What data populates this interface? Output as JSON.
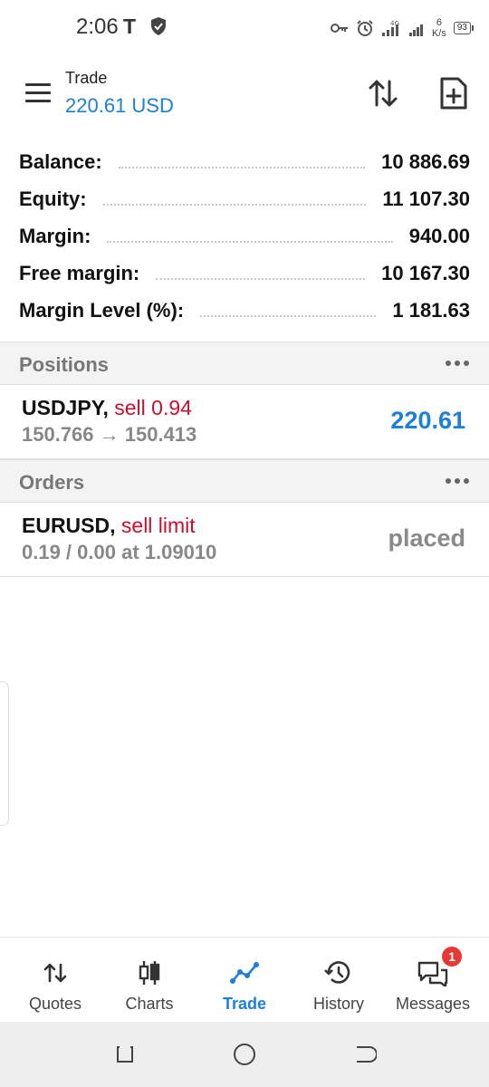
{
  "status_bar": {
    "time": "2:06",
    "carrier_glyph": "T",
    "network_type": "4G",
    "speed_value": "6",
    "speed_unit": "K/s",
    "battery": "93",
    "icons": [
      "shield-icon",
      "key-icon",
      "alarm-icon",
      "signal-icon",
      "signal-icon"
    ]
  },
  "header": {
    "title": "Trade",
    "subtitle": "220.61 USD",
    "accent_color": "#1e7fd6",
    "icons": [
      "menu-icon",
      "sort-icon",
      "new-order-icon"
    ]
  },
  "summary": [
    {
      "label": "Balance:",
      "value": "10 886.69"
    },
    {
      "label": "Equity:",
      "value": "11 107.30"
    },
    {
      "label": "Margin:",
      "value": "940.00"
    },
    {
      "label": "Free margin:",
      "value": "10 167.30"
    },
    {
      "label": "Margin Level (%):",
      "value": "1 181.63"
    }
  ],
  "positions": {
    "title": "Positions",
    "items": [
      {
        "symbol": "USDJPY,",
        "type": "sell 0.94",
        "prices": "150.766 → 150.413",
        "value": "220.61"
      }
    ]
  },
  "orders": {
    "title": "Orders",
    "items": [
      {
        "symbol": "EURUSD,",
        "type": "sell limit",
        "detail": "0.19 / 0.00 at 1.09010",
        "status": "placed"
      }
    ]
  },
  "bottom_nav": [
    {
      "label": "Quotes",
      "icon": "quotes-icon"
    },
    {
      "label": "Charts",
      "icon": "charts-icon"
    },
    {
      "label": "Trade",
      "icon": "trade-icon",
      "active": true
    },
    {
      "label": "History",
      "icon": "history-icon"
    },
    {
      "label": "Messages",
      "icon": "messages-icon",
      "badge": "1"
    }
  ],
  "colors": {
    "sell": "#c8102e",
    "profit": "#1e7fd6",
    "badge": "#e53935"
  }
}
